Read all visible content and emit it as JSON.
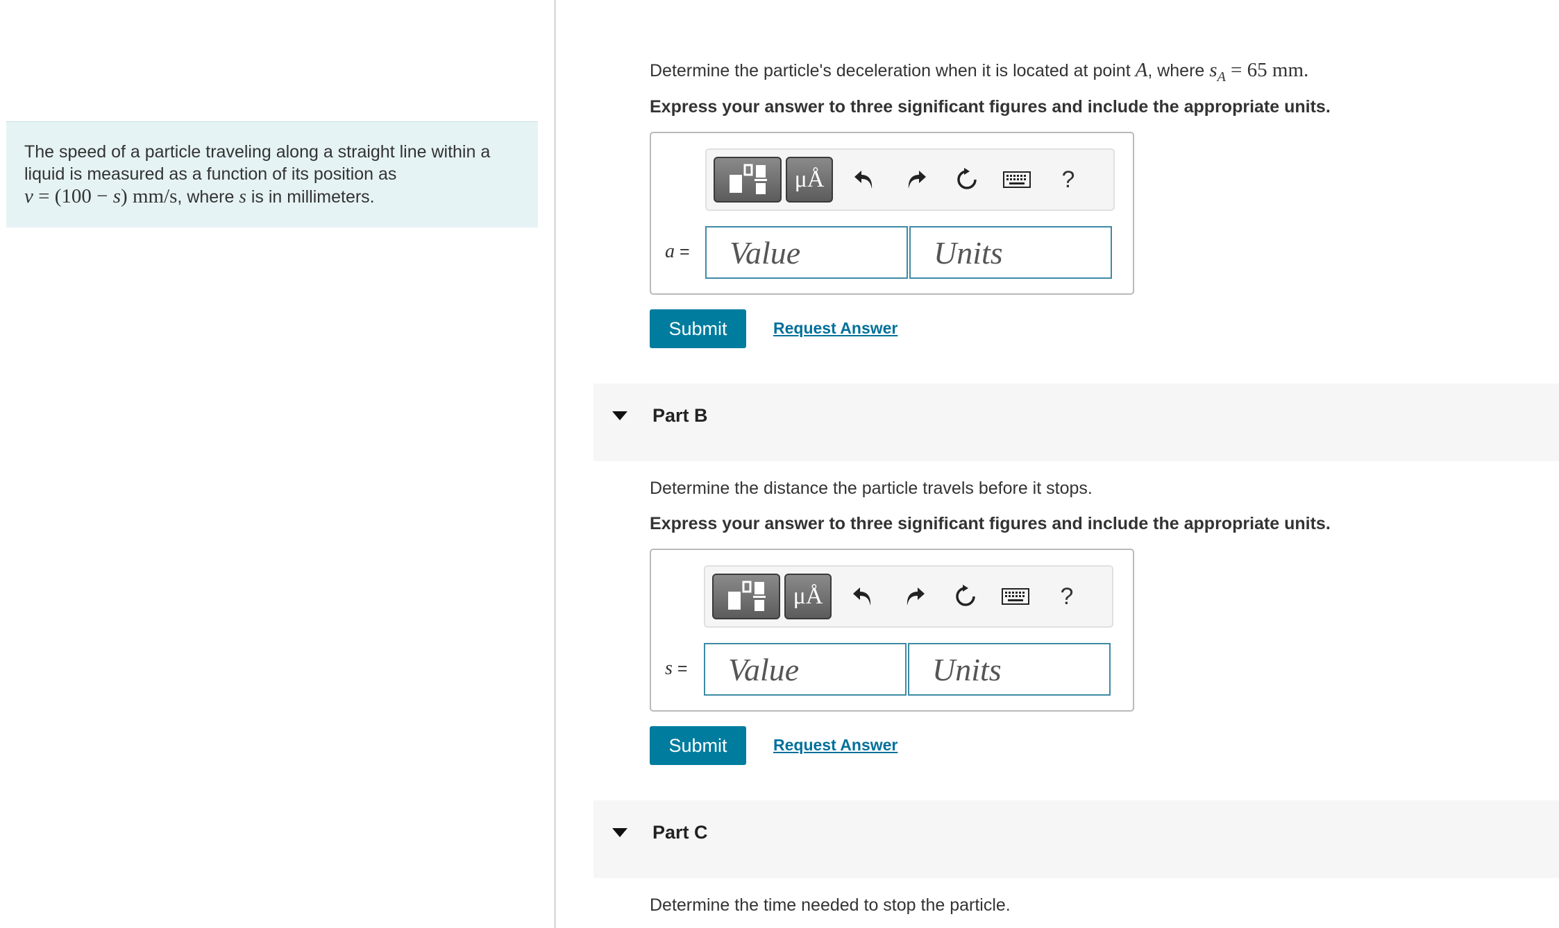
{
  "problem": {
    "text_1": "The speed of a particle traveling along a straight line within a",
    "text_2": "liquid is measured as a function of its position as",
    "eq_v": "v",
    "eq_body": " = (100 − ",
    "eq_s": "s",
    "eq_tail": ") mm/s",
    "text_3a": ", where ",
    "text_3_var": "s",
    "text_3b": " is in millimeters."
  },
  "part_a": {
    "question_prefix": "Determine the particle's deceleration when it is located at point ",
    "point": "A",
    "question_mid": ", where ",
    "sub_var": "s",
    "sub_index": "A",
    "question_value": " = 65 mm.",
    "instruction": "Express your answer to three significant figures and include the appropriate units.",
    "variable": "a",
    "equals": " =",
    "value_placeholder": "Value",
    "units_placeholder": "Units",
    "submit_label": "Submit",
    "request_label": "Request Answer"
  },
  "part_b": {
    "header": "Part B",
    "question": "Determine the distance the particle travels before it stops.",
    "instruction": "Express your answer to three significant figures and include the appropriate units.",
    "variable": "s",
    "equals": " =",
    "value_placeholder": "Value",
    "units_placeholder": "Units",
    "submit_label": "Submit",
    "request_label": "Request Answer"
  },
  "part_c": {
    "header": "Part C",
    "question": "Determine the time needed to stop the particle."
  },
  "toolbar": {
    "units_label": "μÅ",
    "help_label": "?",
    "icons": [
      "templates-icon",
      "units-icon",
      "undo-icon",
      "redo-icon",
      "reset-icon",
      "keyboard-icon",
      "help-icon"
    ]
  }
}
